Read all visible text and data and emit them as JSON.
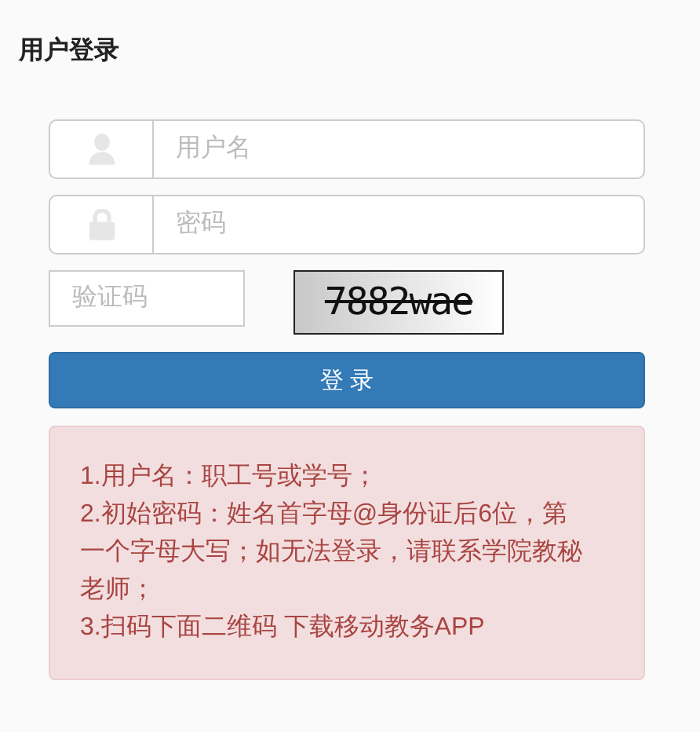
{
  "title": "用户登录",
  "fields": [
    {
      "kind": "user",
      "placeholder": "用户名"
    },
    {
      "kind": "lock",
      "placeholder": "密码"
    }
  ],
  "captcha": {
    "placeholder": "验证码",
    "code": "7882wae"
  },
  "login_button": "登 录",
  "notes": [
    "1.用户名：职工号或学号；",
    "2.初始密码：姓名首字母@身份证后6位，第一个字母大写；如无法登录，请联系学院教秘老师；",
    "3.扫码下面二维码 下载移动教务APP"
  ]
}
